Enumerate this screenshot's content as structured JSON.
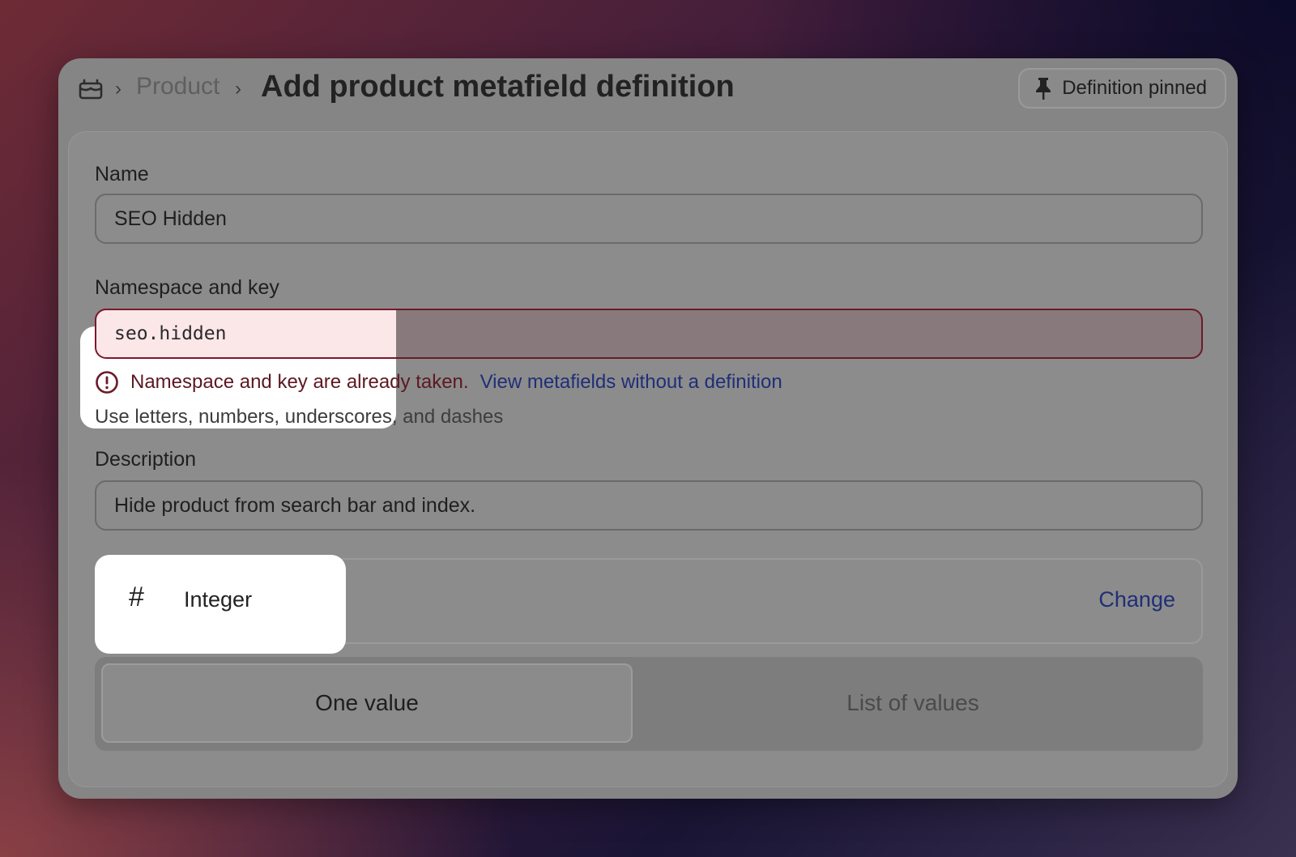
{
  "header": {
    "breadcrumb_product": "Product",
    "title": "Add product metafield definition",
    "pin_button_label": "Definition pinned"
  },
  "form": {
    "name_label": "Name",
    "name_value": "SEO Hidden",
    "namespace_label": "Namespace and key",
    "namespace_value": "seo.hidden",
    "error_text": "Namespace and key are already taken.",
    "error_link": "View metafields without a definition",
    "help_text": "Use letters, numbers, underscores, and dashes",
    "description_label": "Description",
    "description_value": "Hide product from search bar and index.",
    "type_icon": "#",
    "type_label": "Integer",
    "change_label": "Change",
    "segment_one": "One value",
    "segment_list": "List of values"
  },
  "colors": {
    "error": "#7a1a2a",
    "link": "#1f2f78",
    "highlight": "#ffffff"
  },
  "icons": {
    "store": "store-icon",
    "pin": "pin-icon",
    "error": "alert-circle-icon",
    "type": "hash-icon"
  }
}
